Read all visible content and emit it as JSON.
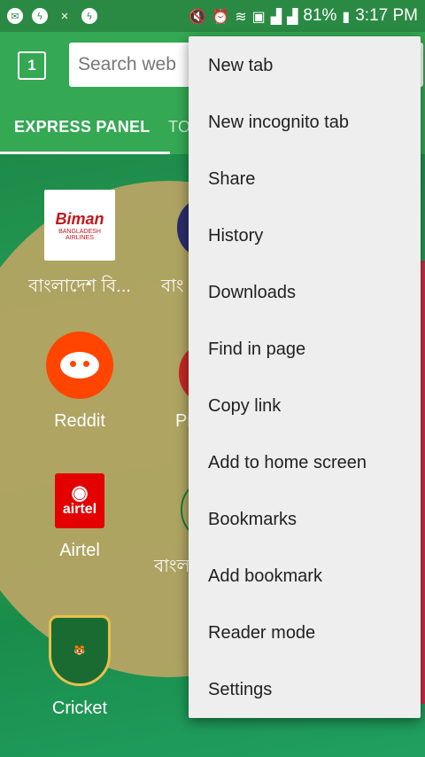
{
  "status_bar": {
    "notification_icons": [
      "message-icon",
      "messenger-icon",
      "missed-call-icon",
      "messenger-icon"
    ],
    "system_icons": [
      "mute-icon",
      "alarm-icon",
      "wifi-icon",
      "nfc-icon",
      "signal-icon",
      "signal-icon",
      "battery-charging-icon"
    ],
    "battery": "81%",
    "time": "3:17 PM"
  },
  "toolbar": {
    "tab_count": "1",
    "search_placeholder": "Search web"
  },
  "tabs": [
    {
      "label": "EXPRESS PANEL"
    },
    {
      "label": "TO"
    }
  ],
  "speed_dials": [
    {
      "label": "বাংলাদেশ বি...",
      "logo": "Biman",
      "logo_sub": "BANGLADESH AIRLINES"
    },
    {
      "label": "বাং"
    },
    {
      "label": "Reddit"
    },
    {
      "label": "Pr"
    },
    {
      "label": "Airtel",
      "logo": "airtel"
    },
    {
      "label": "বাংল"
    },
    {
      "label": "Cricket"
    }
  ],
  "menu": {
    "items": [
      "New tab",
      "New incognito tab",
      "Share",
      "History",
      "Downloads",
      "Find in page",
      "Copy link",
      "Add to home screen",
      "Bookmarks",
      "Add bookmark",
      "Reader mode",
      "Settings"
    ]
  }
}
